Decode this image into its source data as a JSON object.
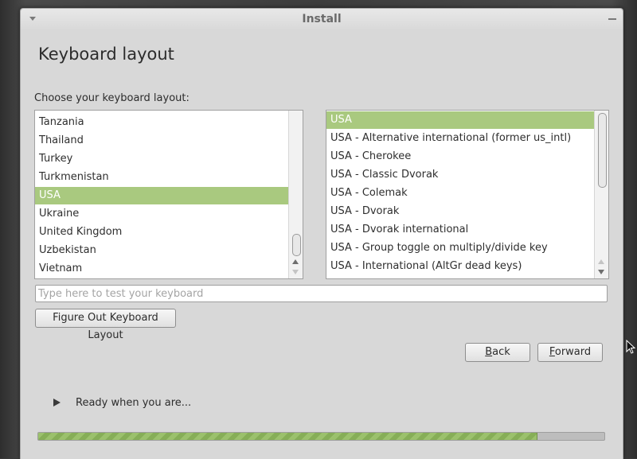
{
  "window": {
    "title": "Install"
  },
  "page": {
    "title": "Keyboard layout",
    "choose_label": "Choose your keyboard layout:"
  },
  "countries": {
    "items": [
      "Tanzania",
      "Thailand",
      "Turkey",
      "Turkmenistan",
      "USA",
      "Ukraine",
      "United Kingdom",
      "Uzbekistan",
      "Vietnam"
    ],
    "selected": "USA"
  },
  "variants": {
    "items": [
      "USA",
      "USA - Alternative international (former us_intl)",
      "USA - Cherokee",
      "USA - Classic Dvorak",
      "USA - Colemak",
      "USA - Dvorak",
      "USA - Dvorak international",
      "USA - Group toggle on multiply/divide key",
      "USA - International (AltGr dead keys)"
    ],
    "selected": "USA"
  },
  "test_field": {
    "placeholder": "Type here to test your keyboard",
    "value": ""
  },
  "buttons": {
    "figure_out": "Figure Out Keyboard Layout",
    "back_mnemonic": "B",
    "back_rest": "ack",
    "forward_mnemonic": "F",
    "forward_rest": "orward"
  },
  "status": {
    "text": "Ready when you are...",
    "progress": 0.88
  },
  "colors": {
    "selection": "#a9c97f",
    "progress": "#9bc16c"
  },
  "icons": {
    "title_menu": "chevron-down-icon",
    "status": "play-icon",
    "minimize": "minimize-icon"
  }
}
